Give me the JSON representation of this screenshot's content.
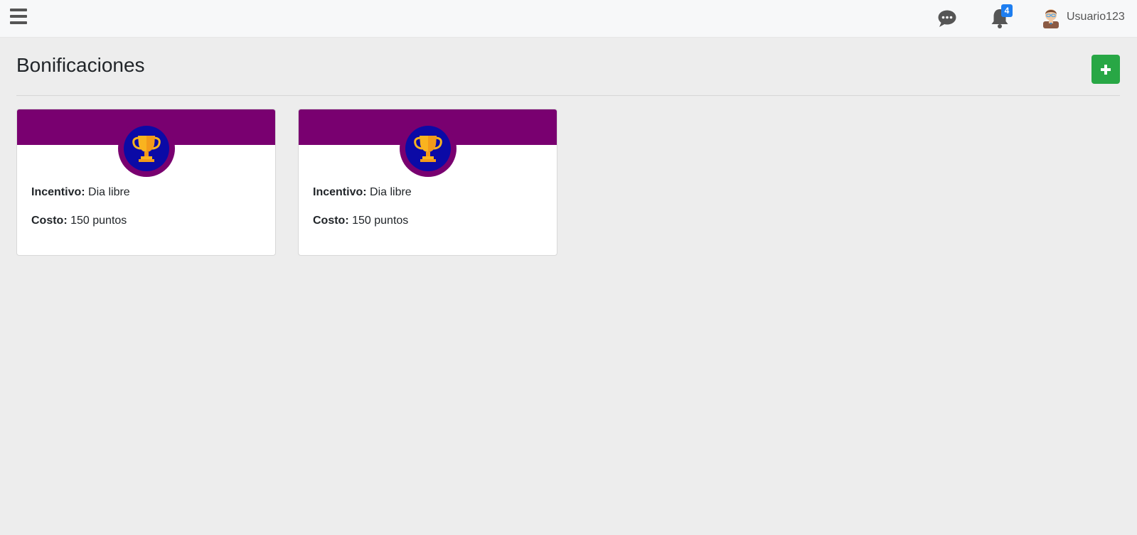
{
  "header": {
    "menu_icon": "hamburger-icon",
    "chat_icon": "chat-bubble-icon",
    "bell_icon": "bell-icon",
    "notification_count": "4",
    "avatar_icon": "user-avatar-icon",
    "username": "Usuario123"
  },
  "page": {
    "title": "Bonificaciones",
    "add_icon": "plus-icon"
  },
  "cards": [
    {
      "icon": "trophy-icon",
      "incentive_label": "Incentivo:",
      "incentive_value": "Dia libre",
      "cost_label": "Costo:",
      "cost_value": "150 puntos"
    },
    {
      "icon": "trophy-icon",
      "incentive_label": "Incentivo:",
      "incentive_value": "Dia libre",
      "cost_label": "Costo:",
      "cost_value": "150 puntos"
    }
  ],
  "colors": {
    "card_header": "#790070",
    "icon_circle": "#0b0aa6",
    "add_button": "#28a745",
    "badge": "#1e7ef0",
    "trophy": "#f9b31f"
  }
}
